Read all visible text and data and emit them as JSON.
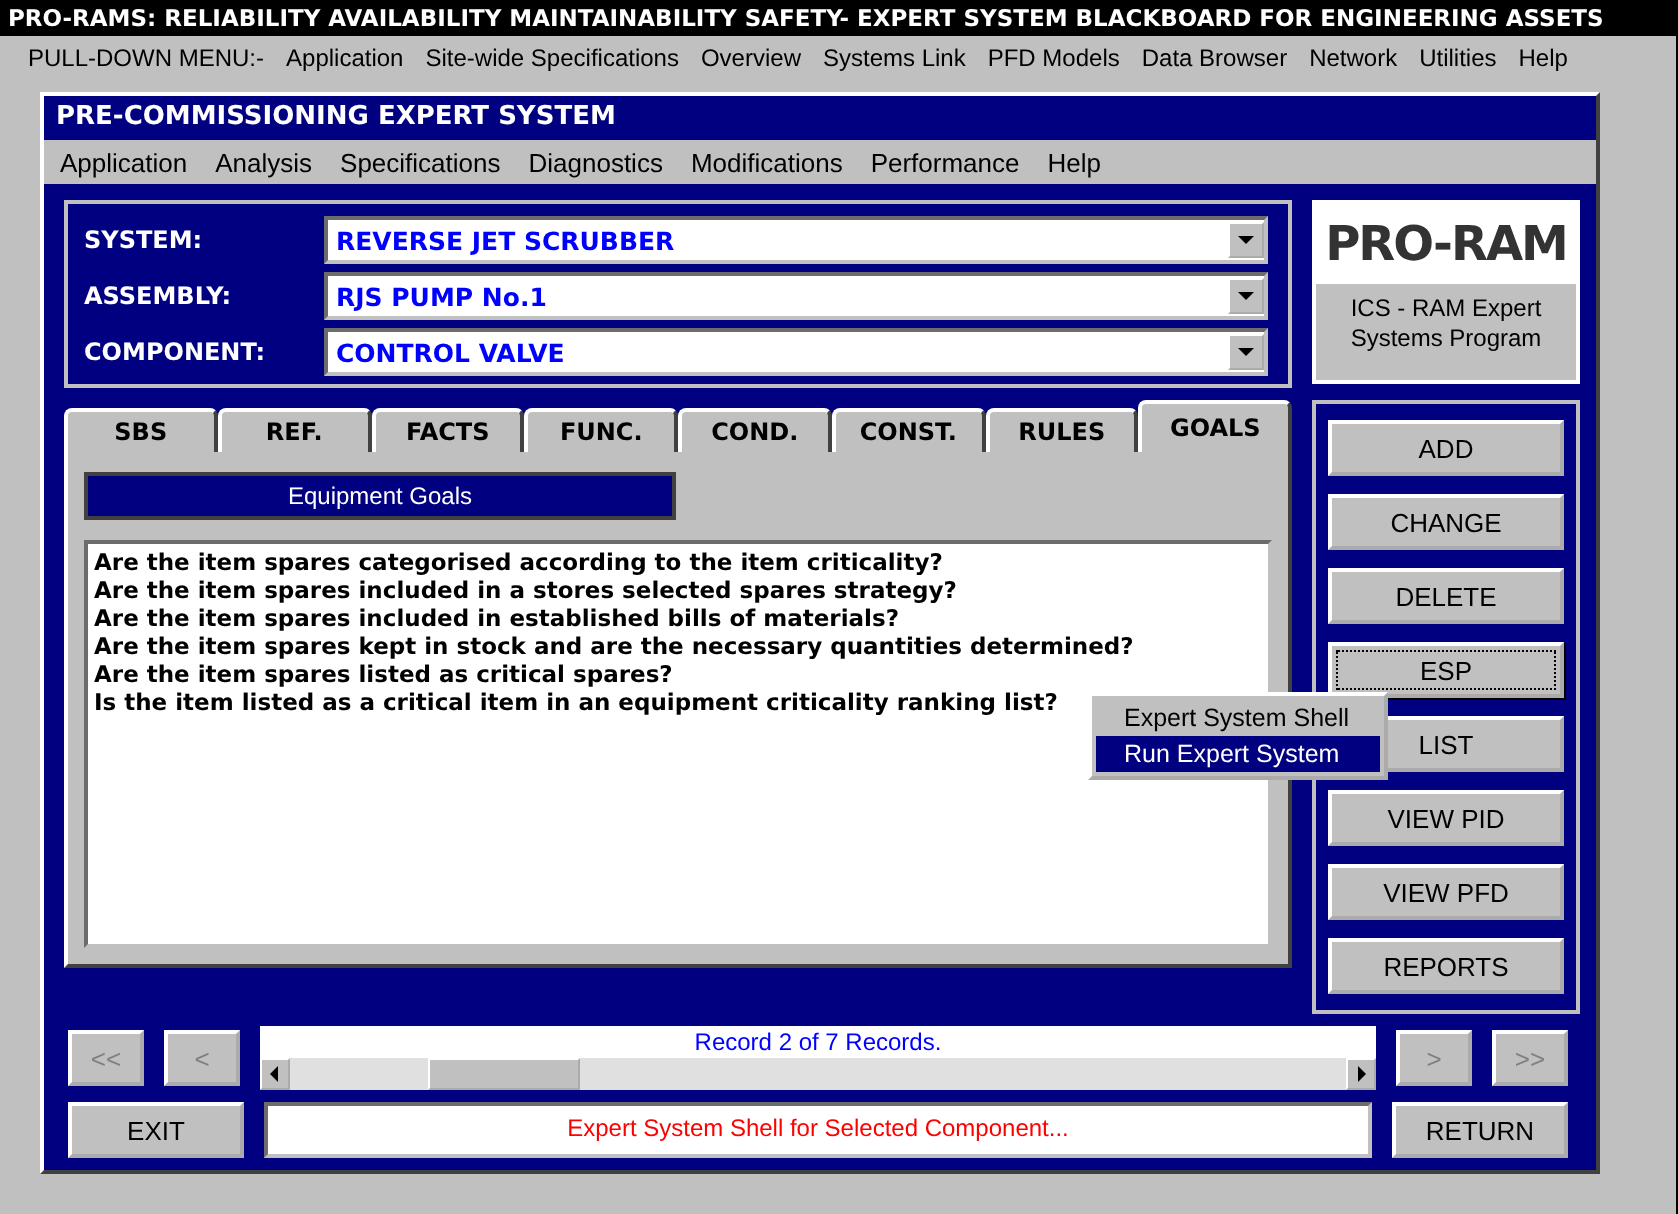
{
  "app_title": "PRO-RAMS: RELIABILITY AVAILABILITY MAINTAINABILITY SAFETY- EXPERT SYSTEM BLACKBOARD FOR ENGINEERING ASSETS",
  "main_menu": {
    "label": "PULL-DOWN MENU:-",
    "items": [
      "Application",
      "Site-wide Specifications",
      "Overview",
      "Systems Link",
      "PFD Models",
      "Data Browser",
      "Network",
      "Utilities",
      "Help"
    ]
  },
  "window": {
    "title": "PRE-COMMISSIONING EXPERT SYSTEM",
    "menu": [
      "Application",
      "Analysis",
      "Specifications",
      "Diagnostics",
      "Modifications",
      "Performance",
      "Help"
    ]
  },
  "selectors": [
    {
      "label": "SYSTEM:",
      "value": "REVERSE JET SCRUBBER"
    },
    {
      "label": "ASSEMBLY:",
      "value": "RJS PUMP No.1"
    },
    {
      "label": "COMPONENT:",
      "value": "CONTROL VALVE"
    }
  ],
  "logo": {
    "text": "PRO-RAM",
    "caption": "ICS - RAM Expert Systems Program"
  },
  "tabs": [
    {
      "label": "SBS",
      "selected": false
    },
    {
      "label": "REF.",
      "selected": false
    },
    {
      "label": "FACTS",
      "selected": false
    },
    {
      "label": "FUNC.",
      "selected": false
    },
    {
      "label": "COND.",
      "selected": false
    },
    {
      "label": "CONST.",
      "selected": false
    },
    {
      "label": "RULES",
      "selected": false
    },
    {
      "label": "GOALS",
      "selected": true
    }
  ],
  "panel_heading": "Equipment Goals",
  "goals": [
    "Are the item spares categorised according to the item criticality?",
    "Are the item spares included in a stores selected spares strategy?",
    "Are the item spares included in established bills of materials?",
    "Are the item spares kept in stock and are the necessary quantities determined?",
    "Are the item spares listed as critical spares?",
    "Is the item listed as a critical item in an equipment criticality ranking list?"
  ],
  "action_buttons": [
    {
      "label": "ADD",
      "focused": false
    },
    {
      "label": "CHANGE",
      "focused": false
    },
    {
      "label": "DELETE",
      "focused": false
    },
    {
      "label": "ESP",
      "focused": true
    },
    {
      "label": "LIST",
      "focused": false
    },
    {
      "label": "VIEW PID",
      "focused": false
    },
    {
      "label": "VIEW PFD",
      "focused": false
    },
    {
      "label": "REPORTS",
      "focused": false
    }
  ],
  "popup_menu": [
    {
      "label": "Expert System Shell",
      "selected": false
    },
    {
      "label": "Run Expert System",
      "selected": true
    }
  ],
  "navigation": {
    "first": {
      "label": "<<",
      "disabled": true
    },
    "previous": {
      "label": "<",
      "disabled": true
    },
    "record": "Record 2 of 7 Records.",
    "next": {
      "label": ">",
      "disabled": true
    },
    "last": {
      "label": ">>",
      "disabled": true
    }
  },
  "exit_button": "EXIT",
  "status": "Expert System Shell for Selected Component...",
  "return_button": "RETURN"
}
